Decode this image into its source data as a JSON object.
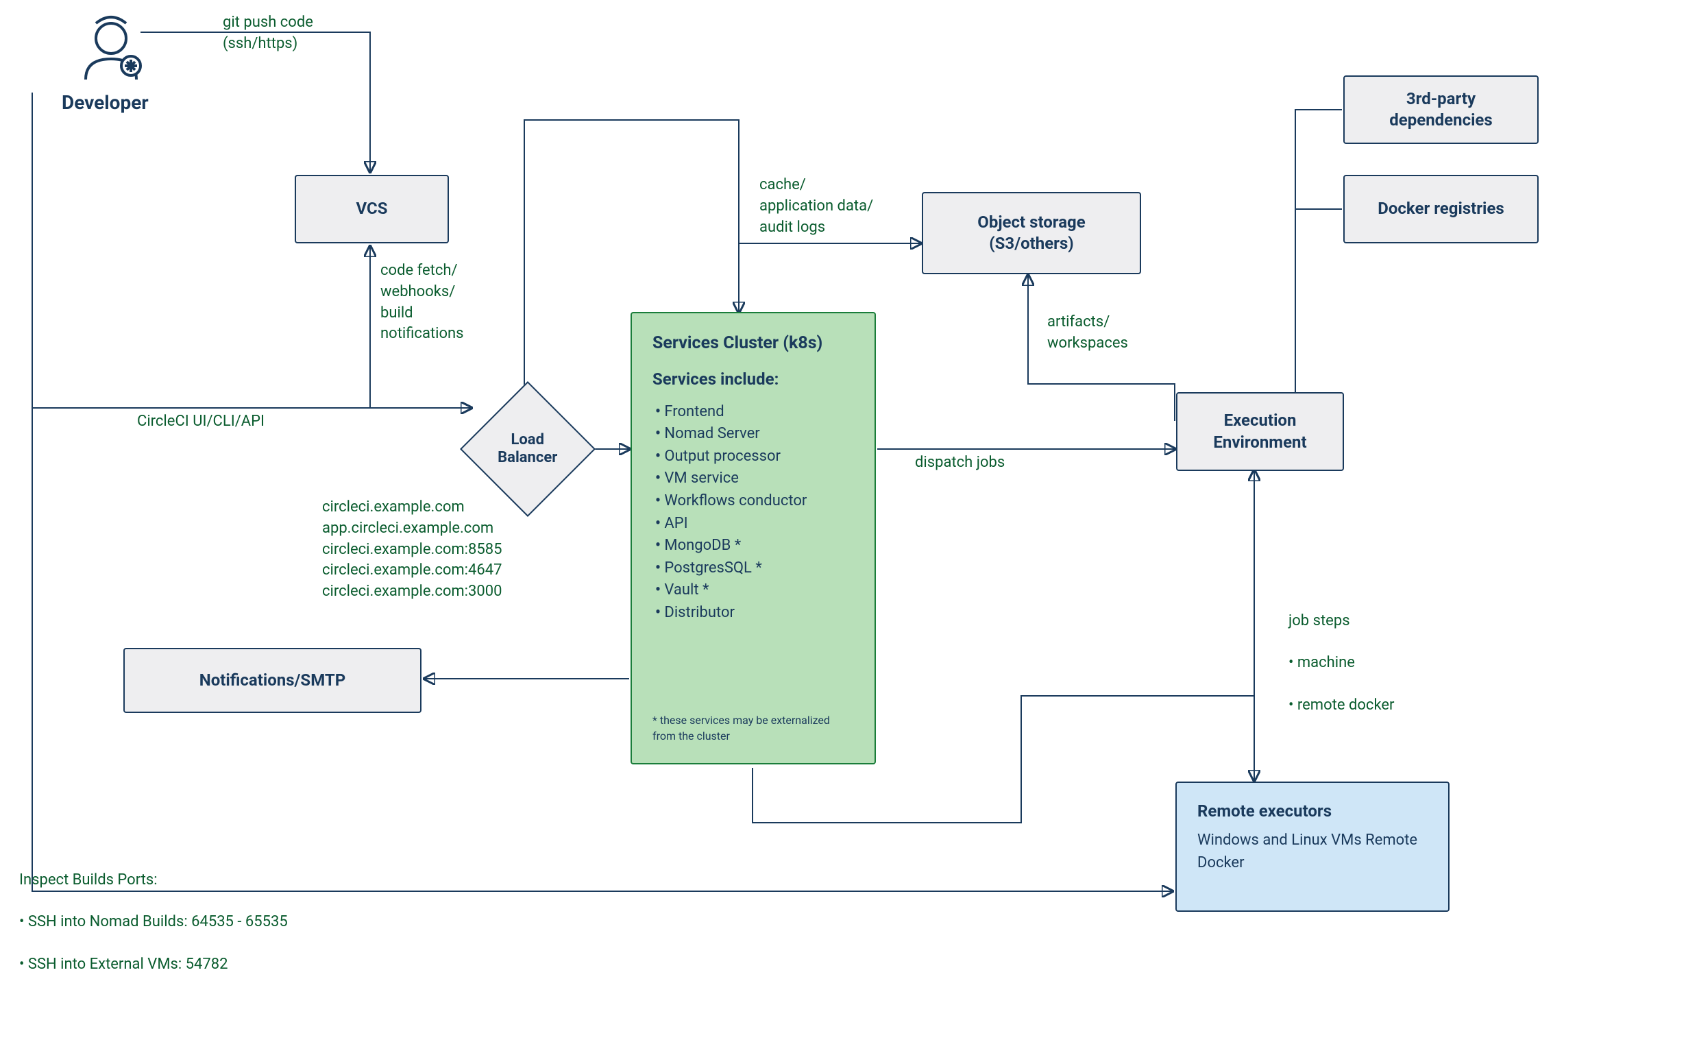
{
  "developer": {
    "label": "Developer"
  },
  "nodes": {
    "vcs": {
      "label": "VCS"
    },
    "load_balancer": {
      "label": "Load\nBalancer"
    },
    "services_cluster": {
      "title": "Services Cluster (k8s)",
      "subtitle": "Services include:",
      "items": [
        "Frontend",
        "Nomad Server",
        "Output processor",
        "VM service",
        "Workflows conductor",
        "API",
        "MongoDB *",
        "PostgresSQL *",
        "Vault *",
        "Distributor"
      ],
      "footnote": "* these services may be externalized\nfrom the cluster"
    },
    "notifications": {
      "label": "Notifications/SMTP"
    },
    "object_storage": {
      "label": "Object storage\n(S3/others)"
    },
    "execution_env": {
      "label": "Execution\nEnvironment"
    },
    "third_party": {
      "label": "3rd-party\ndependencies"
    },
    "docker_registries": {
      "label": "Docker\nregistries"
    },
    "remote_executors": {
      "title": "Remote executors",
      "sub": "Windows and Linux VMs\nRemote Docker"
    }
  },
  "edge_labels": {
    "git_push": "git push code\n(ssh/https)",
    "code_fetch": "code fetch/\nwebhooks/\nbuild\nnotifications",
    "circleci_ui": "CircleCI UI/CLI/API",
    "lb_hosts": "circleci.example.com\napp.circleci.example.com\ncircleci.example.com:8585\ncircleci.example.com:4647\ncircleci.example.com:3000",
    "cache": "cache/\napplication data/\naudit logs",
    "artifacts": "artifacts/\nworkspaces",
    "dispatch": "dispatch jobs",
    "job_steps_title": "job steps",
    "job_steps_items": [
      "machine",
      "remote docker"
    ],
    "inspect_builds_title": "Inspect Builds Ports:",
    "inspect_builds_items": [
      "SSH into Nomad Builds: 64535 - 65535",
      "SSH into External VMs: 54782"
    ]
  }
}
